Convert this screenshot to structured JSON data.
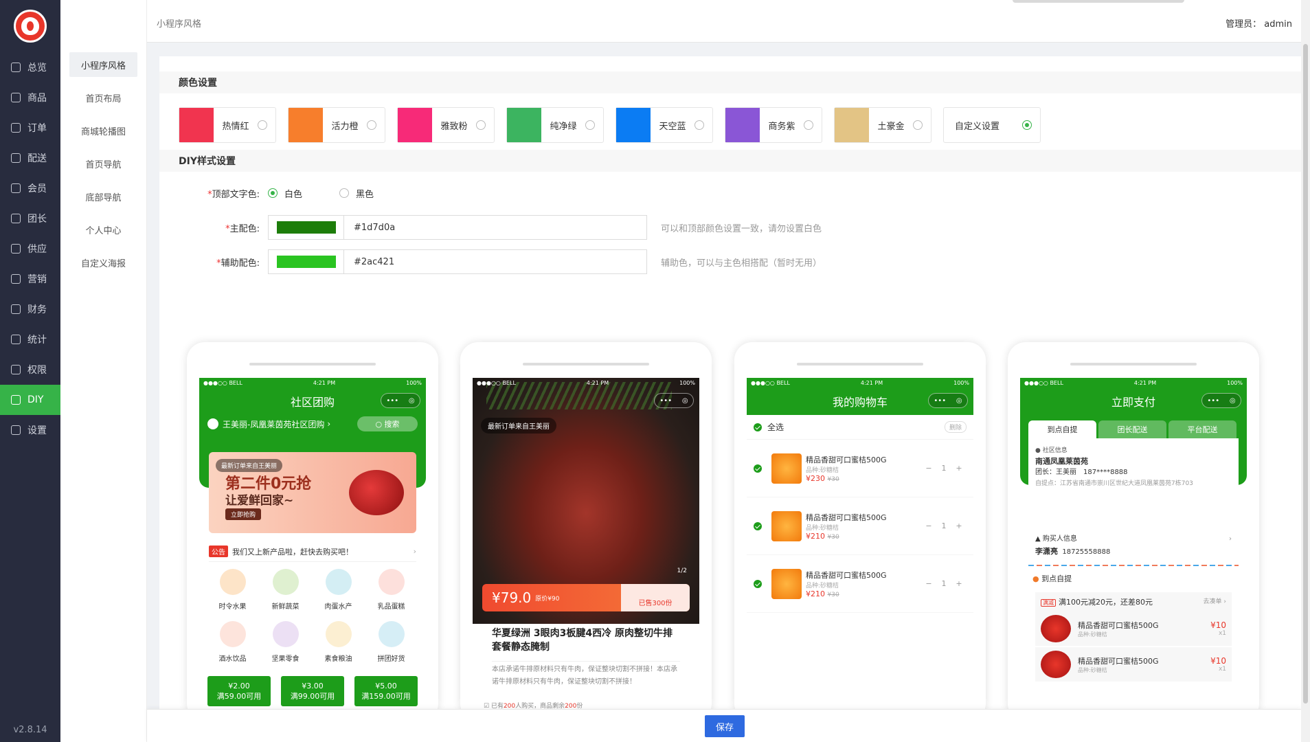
{
  "app": {
    "version": "v2.8.14"
  },
  "sidebar": {
    "items": [
      {
        "label": "总览",
        "icon": "home-icon"
      },
      {
        "label": "商品",
        "icon": "goods-icon"
      },
      {
        "label": "订单",
        "icon": "order-icon"
      },
      {
        "label": "配送",
        "icon": "delivery-icon"
      },
      {
        "label": "会员",
        "icon": "member-icon"
      },
      {
        "label": "团长",
        "icon": "leader-icon"
      },
      {
        "label": "供应",
        "icon": "supply-icon"
      },
      {
        "label": "营销",
        "icon": "gift-icon"
      },
      {
        "label": "财务",
        "icon": "finance-icon"
      },
      {
        "label": "统计",
        "icon": "chart-icon"
      },
      {
        "label": "权限",
        "icon": "shield-icon"
      },
      {
        "label": "DIY",
        "icon": "grid-icon"
      },
      {
        "label": "设置",
        "icon": "gear-icon"
      }
    ],
    "active_index": 11
  },
  "submenu": {
    "items": [
      "小程序风格",
      "首页布局",
      "商城轮播图",
      "首页导航",
      "底部导航",
      "个人中心",
      "自定义海报"
    ],
    "active_index": 0
  },
  "header": {
    "breadcrumb": "小程序风格",
    "admin": "管理员： admin"
  },
  "colors_section": {
    "title": "颜色设置",
    "swatches": [
      {
        "name": "热情红",
        "color": "#f1344f",
        "selected": false
      },
      {
        "name": "活力橙",
        "color": "#f77e2c",
        "selected": false
      },
      {
        "name": "雅致粉",
        "color": "#f72a78",
        "selected": false
      },
      {
        "name": "纯净绿",
        "color": "#3cb460",
        "selected": false
      },
      {
        "name": "天空蓝",
        "color": "#0b7cf3",
        "selected": false
      },
      {
        "name": "商务紫",
        "color": "#8a56d6",
        "selected": false
      },
      {
        "name": "土豪金",
        "color": "#e3c485",
        "selected": false
      }
    ],
    "custom": {
      "name": "自定义设置",
      "selected": true
    }
  },
  "diy_section": {
    "title": "DIY样式设置",
    "text_color": {
      "label": "顶部文字色:",
      "options": [
        "白色",
        "黑色"
      ],
      "selected": 0
    },
    "main_color": {
      "label": "主配色:",
      "value": "#1d7d0a",
      "hint": "可以和顶部颜色设置一致，请勿设置白色"
    },
    "sub_color": {
      "label": "辅助配色:",
      "value": "#2ac421",
      "hint": "辅助色，可以与主色相搭配（暂时无用）"
    }
  },
  "phones": {
    "p1": {
      "status": {
        "carrier": "●●●○○ BELL",
        "time": "4:21 PM",
        "battery": "100%"
      },
      "title": "社区团购",
      "address": "王美丽-凤凰莱茵苑社区团购",
      "search": "搜索",
      "banner": {
        "badge": "最新订单来自王美丽",
        "line1": "第二件0元抢",
        "line2": "让爱鲜回家~",
        "button": "立即抢购"
      },
      "notice": {
        "tag": "公告",
        "text": "我们又上新产品啦，赶快去购买吧！"
      },
      "categories": [
        {
          "name": "时令水果",
          "color": "#fde4c8"
        },
        {
          "name": "新鲜蔬菜",
          "color": "#dff0d0"
        },
        {
          "name": "肉蛋水产",
          "color": "#d4eef4"
        },
        {
          "name": "乳品蛋糕",
          "color": "#fde0dc"
        },
        {
          "name": "酒水饮品",
          "color": "#fde4dc"
        },
        {
          "name": "坚果零食",
          "color": "#ece0f4"
        },
        {
          "name": "素食粮油",
          "color": "#fcefd2"
        },
        {
          "name": "拼团好货",
          "color": "#d6eef6"
        }
      ],
      "coupons": [
        {
          "amount": "¥2.00",
          "cond": "满59.00可用"
        },
        {
          "amount": "¥3.00",
          "cond": "满99.00可用"
        },
        {
          "amount": "¥5.00",
          "cond": "满159.00可用"
        }
      ]
    },
    "p2": {
      "status": {
        "carrier": "●●●○○ BELL",
        "time": "4:21 PM",
        "battery": "100%"
      },
      "badge": "最新订单来自王美丽",
      "page": "1/2",
      "price": "¥79.0",
      "orig": "原价¥90",
      "sold": "已售300份",
      "title": "华夏绿洲 3眼肉3板腱4西冷 原肉整切牛排套餐静态腌制",
      "desc": "本店承诺牛排原材料只有牛肉，保证整块切割不拼接！本店承诺牛排原材料只有牛肉，保证整块切割不拼接！",
      "foot_prefix": "已有",
      "foot_buyers": "200",
      "foot_mid": "人购买，商品剩余",
      "foot_left": "200",
      "foot_suffix": "份"
    },
    "p3": {
      "status": {
        "carrier": "●●●○○ BELL",
        "time": "4:21 PM",
        "battery": "100%"
      },
      "title": "我的购物车",
      "select_all": "全选",
      "delete": "删除",
      "items": [
        {
          "name": "精品香甜可口蜜桔500G",
          "spec": "品种:砂糖桔",
          "price": "¥230",
          "orig": "¥30",
          "qty": "1"
        },
        {
          "name": "精品香甜可口蜜桔500G",
          "spec": "品种:砂糖桔",
          "price": "¥210",
          "orig": "¥30",
          "qty": "1"
        },
        {
          "name": "精品香甜可口蜜桔500G",
          "spec": "品种:砂糖桔",
          "price": "¥210",
          "orig": "¥30",
          "qty": "1"
        }
      ]
    },
    "p4": {
      "status": {
        "carrier": "●●●○○ BELL",
        "time": "4:21 PM",
        "battery": "100%"
      },
      "title": "立即支付",
      "tabs": [
        "到点自提",
        "团长配送",
        "平台配送"
      ],
      "community_label": "社区信息",
      "community_name": "南通凤凰莱茵苑",
      "leader": "团长：王美丽　187****8888",
      "pickup_addr": "自提点：江苏省南通市崇川区世纪大道凤凰莱茵苑7栋703",
      "buyer_label": "购买人信息",
      "buyer_name": "李潇亮",
      "buyer_phone": "18725558888",
      "pick_label": "到点自提",
      "promo_tag": "满减",
      "promo": "满100元减20元，还差80元",
      "promo_go": "去凑单 ›",
      "items": [
        {
          "name": "精品香甜可口蜜桔500G",
          "spec": "品种:砂糖桔",
          "price": "¥10",
          "qty": "x1"
        },
        {
          "name": "精品香甜可口蜜桔500G",
          "spec": "品种:砂糖桔",
          "price": "¥10",
          "qty": "x1"
        }
      ]
    }
  },
  "footer": {
    "save": "保存"
  }
}
